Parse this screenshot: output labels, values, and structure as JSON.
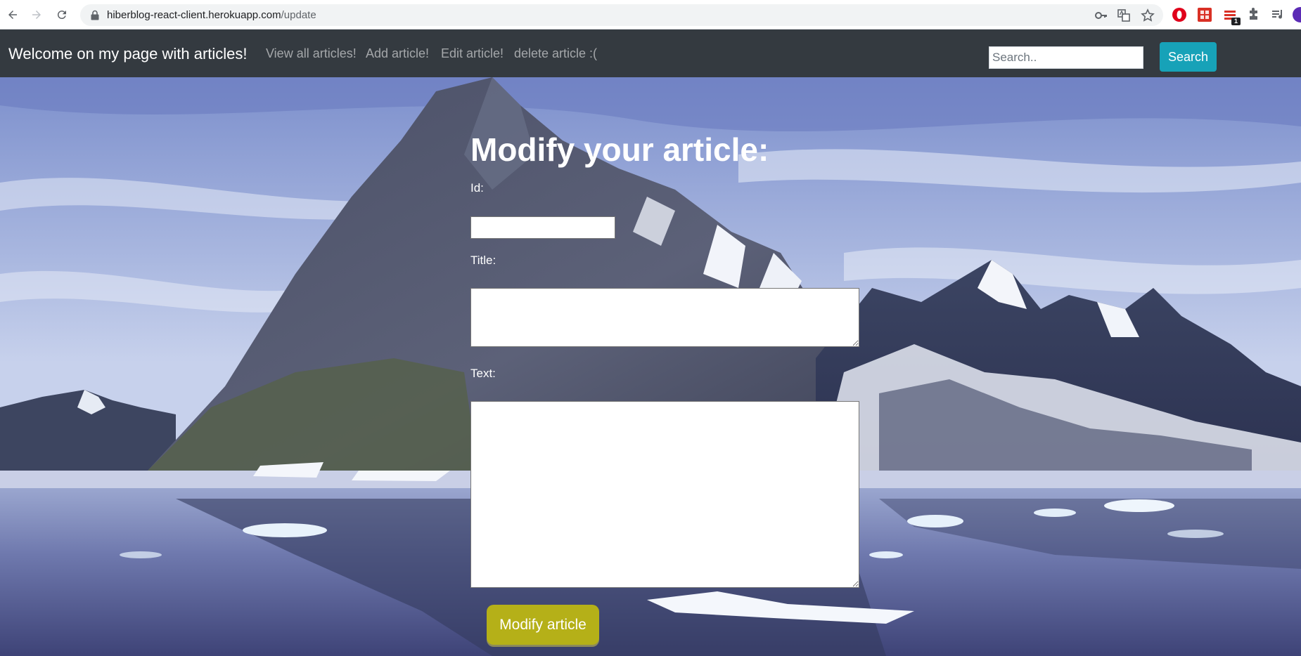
{
  "browser": {
    "url_host": "hiberblog-react-client.herokuapp.com",
    "url_path": "/update",
    "extension_badge": "1"
  },
  "navbar": {
    "brand": "Welcome on my page with articles!",
    "links": [
      {
        "label": "View all articles!"
      },
      {
        "label": "Add article!"
      },
      {
        "label": "Edit article!"
      },
      {
        "label": "delete article :("
      }
    ],
    "search": {
      "placeholder": "Search..",
      "button_label": "Search"
    }
  },
  "form": {
    "title": "Modify your article:",
    "id_label": "Id:",
    "id_value": "",
    "title_label": "Title:",
    "title_value": "",
    "text_label": "Text:",
    "text_value": "",
    "submit_label": "Modify article"
  },
  "colors": {
    "navbar_bg": "#343a40",
    "search_button": "#17a2b8",
    "submit_button": "#b5b018"
  }
}
